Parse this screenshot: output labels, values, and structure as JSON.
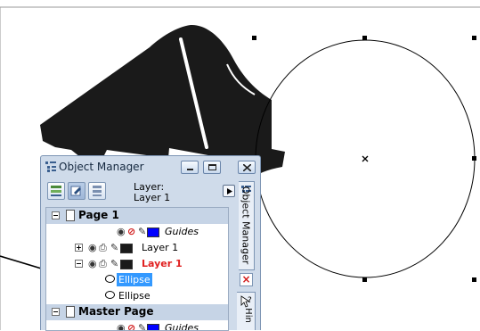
{
  "panel": {
    "title": "Object Manager",
    "layer_label": "Layer:",
    "layer_value": "Layer 1"
  },
  "tree": {
    "page1": "Page 1",
    "guides1": "Guides",
    "layer1a": "Layer 1",
    "layer1b": "Layer 1",
    "ellipse1": "Ellipse",
    "ellipse2": "Ellipse",
    "master": "Master Page",
    "guides2": "Guides"
  },
  "tabs": {
    "object_manager": "Object Manager",
    "hints": "Hin",
    "close_glyph": "×"
  },
  "colors": {
    "active_layer_text": "#e02020",
    "selection": "#3399ff",
    "guides_swatch": "#0000ff",
    "layer_swatch": "#1a1a1a",
    "piano": "#1a1a1a"
  },
  "icons": {
    "eye": "eye-icon",
    "print": "printer-icon",
    "edit": "pencil-icon",
    "no_print": "no-print-icon"
  }
}
